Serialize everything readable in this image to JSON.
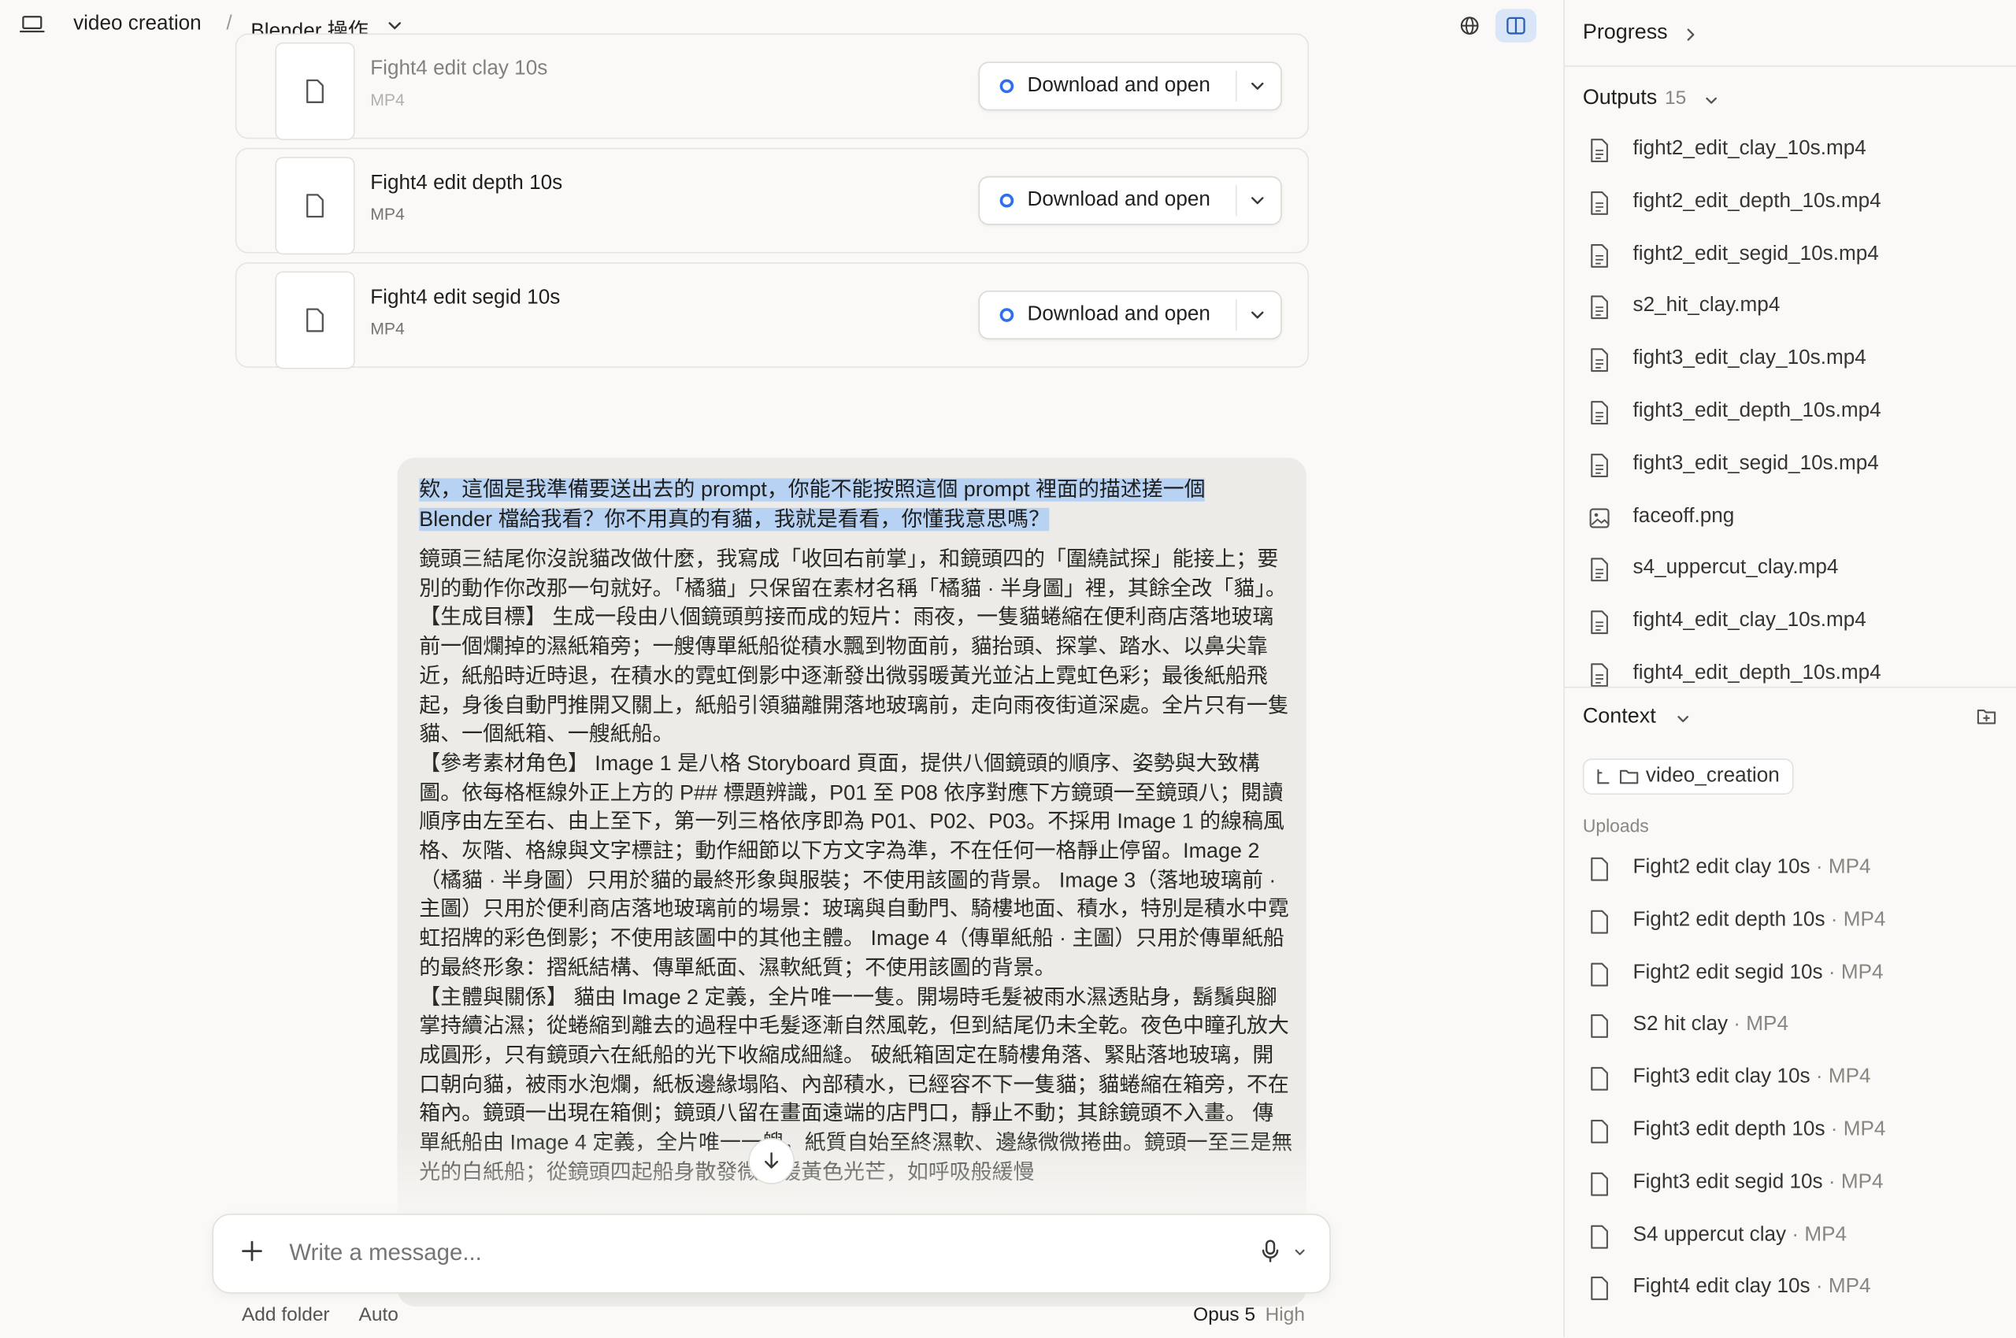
{
  "header": {
    "project": "video creation",
    "separator": "/",
    "chat_title": "Blender 操作"
  },
  "files": [
    {
      "name": "Fight4 edit clay 10s",
      "kind": "MP4",
      "action": "Download and open"
    },
    {
      "name": "Fight4 edit depth 10s",
      "kind": "MP4",
      "action": "Download and open"
    },
    {
      "name": "Fight4 edit segid 10s",
      "kind": "MP4",
      "action": "Download and open"
    }
  ],
  "message": {
    "highlighted": "欸，這個是我準備要送出去的 prompt，你能不能按照這個 prompt 裡面的描述搓一個 Blender 檔給我看？你不用真的有貓，我就是看看，你懂我意思嗎？",
    "body": "鏡頭三結尾你沒說貓改做什麼，我寫成「收回右前掌」，和鏡頭四的「圍繞試探」能接上；要別的動作你改那一句就好。「橘貓」只保留在素材名稱「橘貓 · 半身圖」裡，其餘全改「貓」。\n【生成目標】 生成一段由八個鏡頭剪接而成的短片：雨夜，一隻貓蜷縮在便利商店落地玻璃前一個爛掉的濕紙箱旁；一艘傳單紙船從積水飄到物面前，貓抬頭、探掌、踏水、以鼻尖靠近，紙船時近時退，在積水的霓虹倒影中逐漸發出微弱暖黃光並沾上霓虹色彩；最後紙船飛起，身後自動門推開又關上，紙船引領貓離開落地玻璃前，走向雨夜街道深處。全片只有一隻貓、一個紙箱、一艘紙船。\n【參考素材角色】 Image 1 是八格 Storyboard 頁面，提供八個鏡頭的順序、姿勢與大致構圖。依每格框線外正上方的 P## 標題辨識，P01 至 P08 依序對應下方鏡頭一至鏡頭八；閱讀順序由左至右、由上至下，第一列三格依序即為 P01、P02、P03。不採用 Image 1 的線稿風格、灰階、格線與文字標註；動作細節以下方文字為準，不在任何一格靜止停留。Image 2（橘貓 · 半身圖）只用於貓的最終形象與服裝；不使用該圖的背景。 Image 3（落地玻璃前 · 主圖）只用於便利商店落地玻璃前的場景：玻璃與自動門、騎樓地面、積水，特別是積水中霓虹招牌的彩色倒影；不使用該圖中的其他主體。 Image 4（傳單紙船 · 主圖）只用於傳單紙船的最終形象：摺紙結構、傳單紙面、濕軟紙質；不使用該圖的背景。\n【主體與關係】 貓由 Image 2 定義，全片唯一一隻。開場時毛髮被雨水濕透貼身，鬍鬚與腳掌持續沾濕；從蜷縮到離去的過程中毛髮逐漸自然風乾，但到結尾仍未全乾。夜色中瞳孔放大成圓形，只有鏡頭六在紙船的光下收縮成細縫。 破紙箱固定在騎樓角落、緊貼落地玻璃，開口朝向貓，被雨水泡爛，紙板邊緣塌陷、內部積水，已經容不下一隻貓；貓蜷縮在箱旁，不在箱內。鏡頭一出現在箱側；鏡頭八留在畫面遠端的店門口，靜止不動；其餘鏡頭不入畫。 傳單紙船由 Image 4 定義，全片唯一一艘，紙質自始至終濕軟、邊緣微微捲曲。鏡頭一至三是無光的白紙船；從鏡頭四起船身散發微弱暖黃色光芒，如呼吸般緩慢"
  },
  "composer": {
    "placeholder": "Write a message...",
    "add_folder": "Add folder",
    "mode": "Auto",
    "model": "Opus 5",
    "effort": "High"
  },
  "sidebar": {
    "progress_label": "Progress",
    "outputs_label": "Outputs",
    "outputs_count": "15",
    "outputs": [
      {
        "name": "fight2_edit_clay_10s.mp4",
        "icon": "doc-icon"
      },
      {
        "name": "fight2_edit_depth_10s.mp4",
        "icon": "doc-icon"
      },
      {
        "name": "fight2_edit_segid_10s.mp4",
        "icon": "doc-icon"
      },
      {
        "name": "s2_hit_clay.mp4",
        "icon": "doc-icon"
      },
      {
        "name": "fight3_edit_clay_10s.mp4",
        "icon": "doc-icon"
      },
      {
        "name": "fight3_edit_depth_10s.mp4",
        "icon": "doc-icon"
      },
      {
        "name": "fight3_edit_segid_10s.mp4",
        "icon": "doc-icon"
      },
      {
        "name": "faceoff.png",
        "icon": "image-icon"
      },
      {
        "name": "s4_uppercut_clay.mp4",
        "icon": "doc-icon"
      },
      {
        "name": "fight4_edit_clay_10s.mp4",
        "icon": "doc-icon"
      },
      {
        "name": "fight4_edit_depth_10s.mp4",
        "icon": "doc-icon"
      }
    ],
    "context_label": "Context",
    "context_folder": "video_creation",
    "uploads_label": "Uploads",
    "uploads": [
      {
        "name": "Fight2 edit clay 10s",
        "kind": "MP4"
      },
      {
        "name": "Fight2 edit depth 10s",
        "kind": "MP4"
      },
      {
        "name": "Fight2 edit segid 10s",
        "kind": "MP4"
      },
      {
        "name": "S2 hit clay",
        "kind": "MP4"
      },
      {
        "name": "Fight3 edit clay 10s",
        "kind": "MP4"
      },
      {
        "name": "Fight3 edit depth 10s",
        "kind": "MP4"
      },
      {
        "name": "Fight3 edit segid 10s",
        "kind": "MP4"
      },
      {
        "name": "S4 uppercut clay",
        "kind": "MP4"
      },
      {
        "name": "Fight4 edit clay 10s",
        "kind": "MP4"
      }
    ],
    "uploads_separator": " · "
  }
}
